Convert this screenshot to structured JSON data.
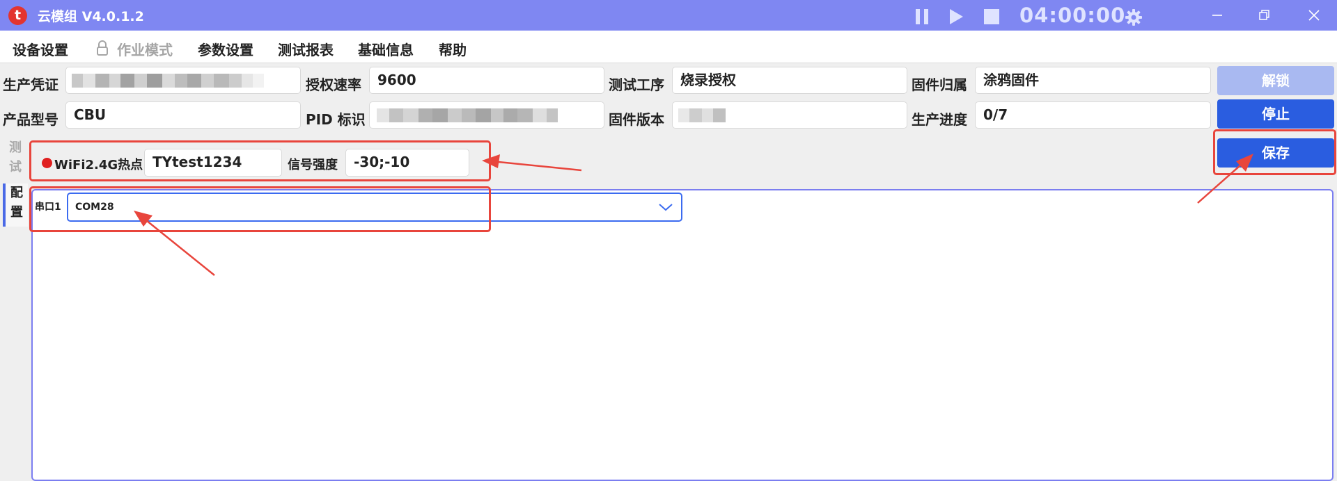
{
  "app": {
    "logo": "t",
    "title": "云模组 V4.0.1.2",
    "timer": "04:00:00"
  },
  "titlebar_icons": [
    "pause-icon",
    "play-icon",
    "stop-icon",
    "gear-icon"
  ],
  "window_controls": [
    "minimize-icon",
    "restore-icon",
    "close-icon"
  ],
  "menu": {
    "items": [
      {
        "label": "设备设置",
        "enabled": true
      },
      {
        "label": "作业模式",
        "enabled": false,
        "icon": "lock-icon"
      },
      {
        "label": "参数设置",
        "enabled": true
      },
      {
        "label": "测试报表",
        "enabled": true
      },
      {
        "label": "基础信息",
        "enabled": true
      },
      {
        "label": "帮助",
        "enabled": true
      }
    ]
  },
  "info": {
    "production_credential": {
      "label": "生产凭证",
      "value": ""
    },
    "auth_rate": {
      "label": "授权速率",
      "value": "9600"
    },
    "test_process": {
      "label": "测试工序",
      "value": "烧录授权"
    },
    "firmware_owner": {
      "label": "固件归属",
      "value": "涂鸦固件"
    },
    "product_model": {
      "label": "产品型号",
      "value": "CBU"
    },
    "pid": {
      "label": "PID 标识",
      "value": ""
    },
    "firmware_version": {
      "label": "固件版本",
      "value": ""
    },
    "production_progress": {
      "label": "生产进度",
      "value": "0/7"
    }
  },
  "buttons": {
    "unlock": "解锁",
    "stop": "停止",
    "save": "保存"
  },
  "tabs": {
    "test": {
      "chars": [
        "测",
        "试"
      ]
    },
    "config": {
      "chars": [
        "配",
        "置"
      ]
    }
  },
  "test_row": {
    "status_color": "#e02020",
    "wifi_label": "WiFi2.4G热点",
    "wifi_value": "TYtest1234",
    "signal_label": "信号强度",
    "signal_value": "-30;-10"
  },
  "config": {
    "port_label": "串口1",
    "port_value": "COM28"
  },
  "colors": {
    "titlebar": "#7f87f2",
    "primary_button": "#2a5de0",
    "disabled_button": "#a9b9f1",
    "annotation": "#e8453c"
  }
}
